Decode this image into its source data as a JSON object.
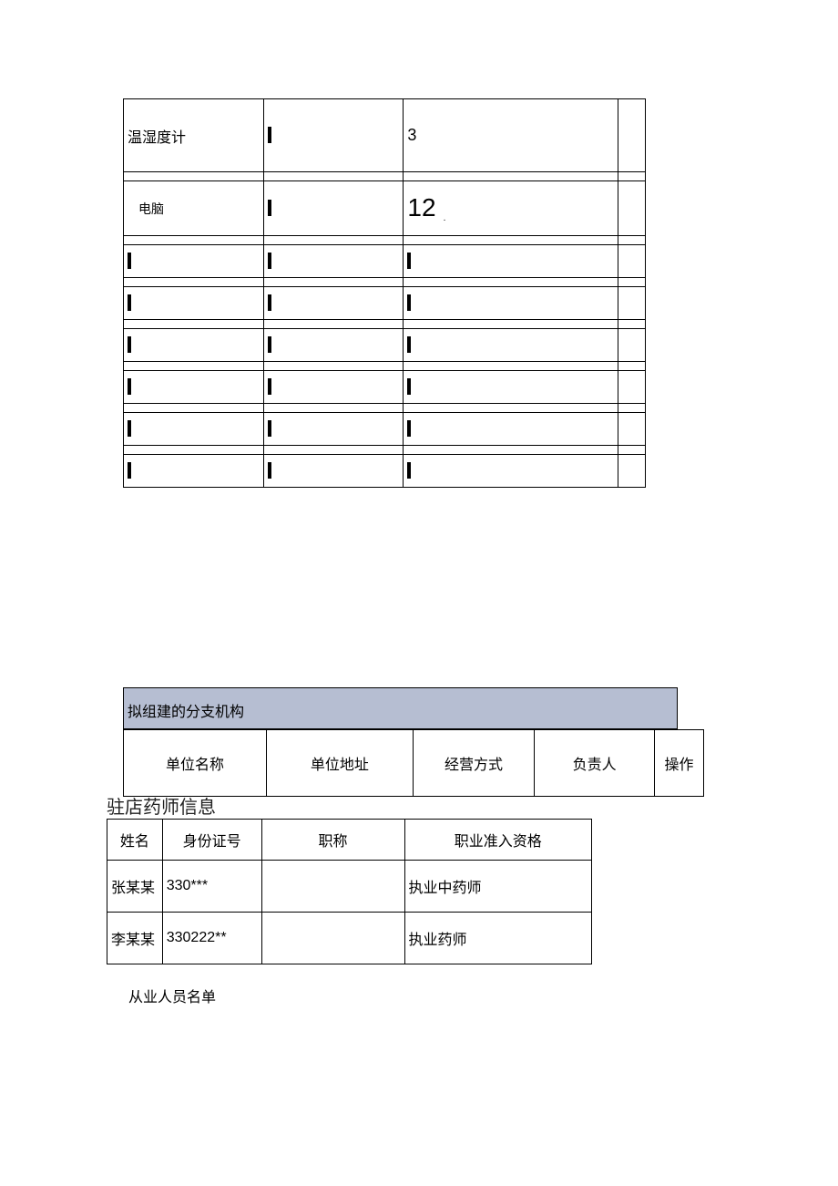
{
  "top_rows": [
    {
      "a": "温湿度计",
      "b": "",
      "c": "3",
      "d": "",
      "h": "tall",
      "barA": false,
      "barB": true,
      "barC": false
    },
    {
      "thin": true
    },
    {
      "a": "电脑",
      "b": "",
      "c": "12",
      "d": "",
      "h": "tallish",
      "small": true,
      "barA": false,
      "barB": true,
      "barC": false,
      "trail": true
    },
    {
      "thin": true
    },
    {
      "a": "",
      "b": "",
      "c": "",
      "d": "",
      "barA": true,
      "barB": true,
      "barC": true
    },
    {
      "thin": true
    },
    {
      "a": "",
      "b": "",
      "c": "",
      "d": "",
      "barA": true,
      "barB": true,
      "barC": true
    },
    {
      "thin": true
    },
    {
      "a": "",
      "b": "",
      "c": "",
      "d": "",
      "barA": true,
      "barB": true,
      "barC": true
    },
    {
      "thin": true
    },
    {
      "a": "",
      "b": "",
      "c": "",
      "d": "",
      "barA": true,
      "barB": true,
      "barC": true
    },
    {
      "thin": true
    },
    {
      "a": "",
      "b": "",
      "c": "",
      "d": "",
      "barA": true,
      "barB": true,
      "barC": true
    },
    {
      "thin": true
    },
    {
      "a": "",
      "b": "",
      "c": "",
      "d": "",
      "barA": true,
      "barB": true,
      "barC": true
    }
  ],
  "branch_header": "拟组建的分支机构",
  "branch_cols": {
    "c1": "单位名称",
    "c2": "单位地址",
    "c3": "经营方式",
    "c4": "负责人",
    "c5": "操作"
  },
  "pharm_title": "驻店药师信息",
  "pharm_headers": {
    "h1": "姓名",
    "h2": "身份证号",
    "h3": "职称",
    "h4": "职业准入资格"
  },
  "pharm_rows": [
    {
      "name": "张某某",
      "id": "330***",
      "title": "",
      "qual": "执业中药师"
    },
    {
      "name": "李某某",
      "id": "330222**",
      "title": "",
      "qual": "执业药师"
    }
  ],
  "staff_title": "从业人员名单"
}
